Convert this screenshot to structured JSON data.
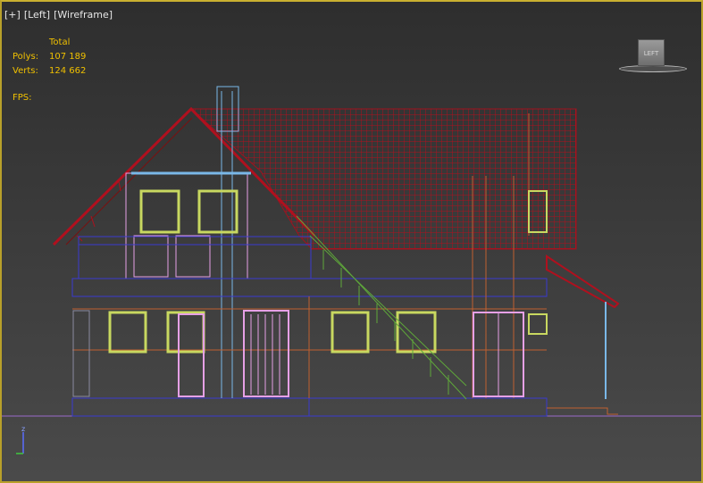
{
  "viewport": {
    "labels": [
      "[+]",
      "[Left]",
      "[Wireframe]"
    ],
    "stats": {
      "header": "Total",
      "rows": [
        {
          "label": "Polys:",
          "value": "107 189"
        },
        {
          "label": "Verts:",
          "value": "124 662"
        }
      ],
      "fps_label": "FPS:"
    },
    "viewcube_label": "LEFT",
    "axis": {
      "z": "z",
      "y": "y"
    }
  },
  "colors": {
    "frame": "#c9b030",
    "roof": "#a0121e",
    "window_frame": "#c8d860",
    "door": "#e6a0e6",
    "stairs": "#5fa83a",
    "wall_lines": "#c06030",
    "floor": "#3a3ad0",
    "ground": "#9a6acb"
  }
}
